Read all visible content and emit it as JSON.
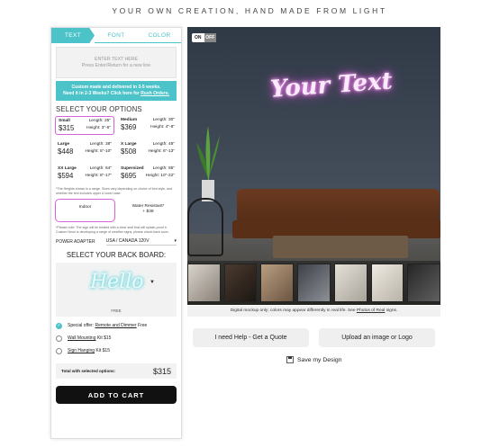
{
  "tagline": "YOUR OWN CREATION, HAND MADE FROM LIGHT",
  "tabs": [
    {
      "label": "TEXT",
      "active": true
    },
    {
      "label": "FONT",
      "active": false
    },
    {
      "label": "COLOR",
      "active": false
    }
  ],
  "text_input": {
    "line1": "ENTER TEXT HERE",
    "line2": "Press Enter/Return for a new line"
  },
  "notice": {
    "line1": "Custom made and delivered in 3-5 weeks.",
    "line2_prefix": "Need it in 2-3 Weeks? Click here for",
    "line2_link": "Rush Orders."
  },
  "options_title": "SELECT YOUR OPTIONS",
  "sizes": [
    {
      "name": "Small",
      "price": "$315",
      "length": "Length: 25\"",
      "height": "Height: 3\"-6\"",
      "selected": true
    },
    {
      "name": "Medium",
      "price": "$369",
      "length": "Length: 30\"",
      "height": "Height: 4\"-8\"",
      "selected": false
    },
    {
      "name": "Large",
      "price": "$448",
      "length": "Length: 38\"",
      "height": "Height: 5\"-10\"",
      "selected": false
    },
    {
      "name": "X Large",
      "price": "$508",
      "length": "Length: 48\"",
      "height": "Height: 6\"-13\"",
      "selected": false
    },
    {
      "name": "XX Large",
      "price": "$594",
      "length": "Length: 64\"",
      "height": "Height: 8\"-17\"",
      "selected": false
    },
    {
      "name": "Supersized",
      "price": "$695",
      "length": "Length: 85\"",
      "height": "Height: 10\"-22\"",
      "selected": false
    }
  ],
  "size_note": "*The Heights shown is a range. Sizes vary depending on choice of font style, and whether the text includes upper & lower case.",
  "types": [
    {
      "line1": "Indoor",
      "line2": "",
      "selected": true
    },
    {
      "line1": "Water Resistant*",
      "line2": "+ $39",
      "selected": false
    }
  ],
  "type_note": "*Please note: The sign will be treated with a clear seal that will splash-proof it. Custom Neon is developing a range of weather signs, please check back soon.",
  "adapter": {
    "label": "POWER ADAPTER",
    "value": "USA / CANADA 120V"
  },
  "backboard": {
    "title": "SELECT YOUR BACK BOARD:",
    "preview_text": "Hello",
    "label": "FREE"
  },
  "addons": [
    {
      "prefix": "Special offer:",
      "link": "Remote and Dimmer",
      "suffix": "Free",
      "checked": true
    },
    {
      "prefix": "",
      "link": "Wall Mounting",
      "suffix": "Kit $15",
      "checked": false
    },
    {
      "prefix": "",
      "link": "Sign Hanging",
      "suffix": "Kit $15",
      "checked": false
    }
  ],
  "total": {
    "label": "Total with selected options:",
    "amount": "$315"
  },
  "cart_label": "ADD TO CART",
  "preview": {
    "toggle_on": "ON",
    "toggle_off": "OFF",
    "neon_text": "Your Text",
    "disclaimer_prefix": "Digital mockup only; colors may appear differently in real life. See",
    "disclaimer_link": "Photos of Real",
    "disclaimer_suffix": "signs."
  },
  "buttons": {
    "quote": "I need Help - Get a Quote",
    "upload": "Upload an image or Logo",
    "save": "Save my Design"
  },
  "colors": {
    "accent": "#4cc3c8",
    "highlight": "#d860d8",
    "cart": "#111111"
  }
}
